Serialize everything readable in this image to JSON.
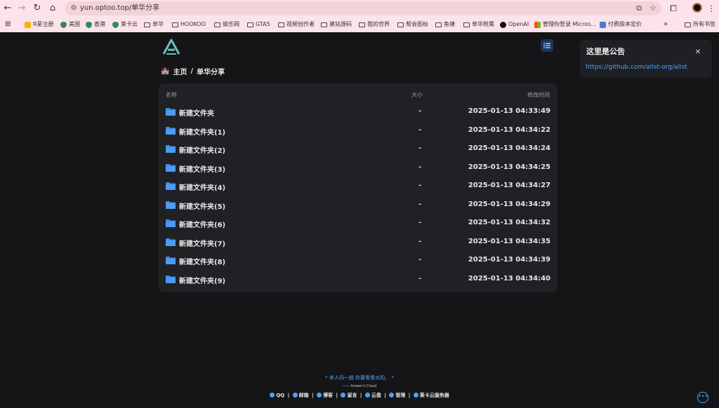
{
  "browser": {
    "url": "yun.optoo.top/单华分享",
    "bookmarks": [
      {
        "label": "R星注册",
        "icon": "rockstar-icon",
        "color": "#f7b500"
      },
      {
        "label": "美国",
        "icon": "shield-icon",
        "color": "#2e8b57"
      },
      {
        "label": "香港",
        "icon": "shield-icon",
        "color": "#2e8b57"
      },
      {
        "label": "莱卡云",
        "icon": "shield-icon",
        "color": "#2e8b57"
      },
      {
        "label": "单华",
        "icon": "folder-icon"
      },
      {
        "label": "HOOKOO",
        "icon": "folder-icon"
      },
      {
        "label": "娱乐网",
        "icon": "folder-icon"
      },
      {
        "label": "GTA5",
        "icon": "folder-icon"
      },
      {
        "label": "视频创作者",
        "icon": "folder-icon"
      },
      {
        "label": "建站源码",
        "icon": "folder-icon"
      },
      {
        "label": "我的世界",
        "icon": "folder-icon"
      },
      {
        "label": "帮会图标",
        "icon": "folder-icon"
      },
      {
        "label": "鱼塘",
        "icon": "folder-icon"
      },
      {
        "label": "单华附属",
        "icon": "folder-icon"
      },
      {
        "label": "OpenAI",
        "icon": "openai-icon"
      },
      {
        "label": "管理你登录 Micros...",
        "icon": "microsoft-icon"
      },
      {
        "label": "付费版本定价",
        "icon": "app-icon"
      }
    ],
    "all_bookmarks": "所有书签"
  },
  "breadcrumb": {
    "home": "主页",
    "separator": "/",
    "current": "单华分享"
  },
  "table": {
    "headers": {
      "name": "名称",
      "size": "大小",
      "modified": "修改时间"
    },
    "rows": [
      {
        "name": "新建文件夹",
        "size": "-",
        "modified": "2025-01-13 04:33:49"
      },
      {
        "name": "新建文件夹(1)",
        "size": "-",
        "modified": "2025-01-13 04:34:22"
      },
      {
        "name": "新建文件夹(2)",
        "size": "-",
        "modified": "2025-01-13 04:34:24"
      },
      {
        "name": "新建文件夹(3)",
        "size": "-",
        "modified": "2025-01-13 04:34:25"
      },
      {
        "name": "新建文件夹(4)",
        "size": "-",
        "modified": "2025-01-13 04:34:27"
      },
      {
        "name": "新建文件夹(5)",
        "size": "-",
        "modified": "2025-01-13 04:34:29"
      },
      {
        "name": "新建文件夹(6)",
        "size": "-",
        "modified": "2025-01-13 04:34:32"
      },
      {
        "name": "新建文件夹(7)",
        "size": "-",
        "modified": "2025-01-13 04:34:35"
      },
      {
        "name": "新建文件夹(8)",
        "size": "-",
        "modified": "2025-01-13 04:34:39"
      },
      {
        "name": "新建文件夹(9)",
        "size": "-",
        "modified": "2025-01-13 04:34:40"
      }
    ]
  },
  "notice": {
    "title": "这里是公告",
    "link": "https://github.com/alist-org/alist"
  },
  "footer": {
    "quote": "* 来人间一趟 你要看看太阳。 *",
    "signature": "—— Anwen's Cloud",
    "links": [
      "QQ",
      "邮箱",
      "博客",
      "留言",
      "云盘",
      "管理",
      "莱卡云服务器"
    ]
  },
  "colors": {
    "accent": "#4aa3ff",
    "folder": "#3b8beb",
    "background": "#151517",
    "panel": "#202124"
  }
}
